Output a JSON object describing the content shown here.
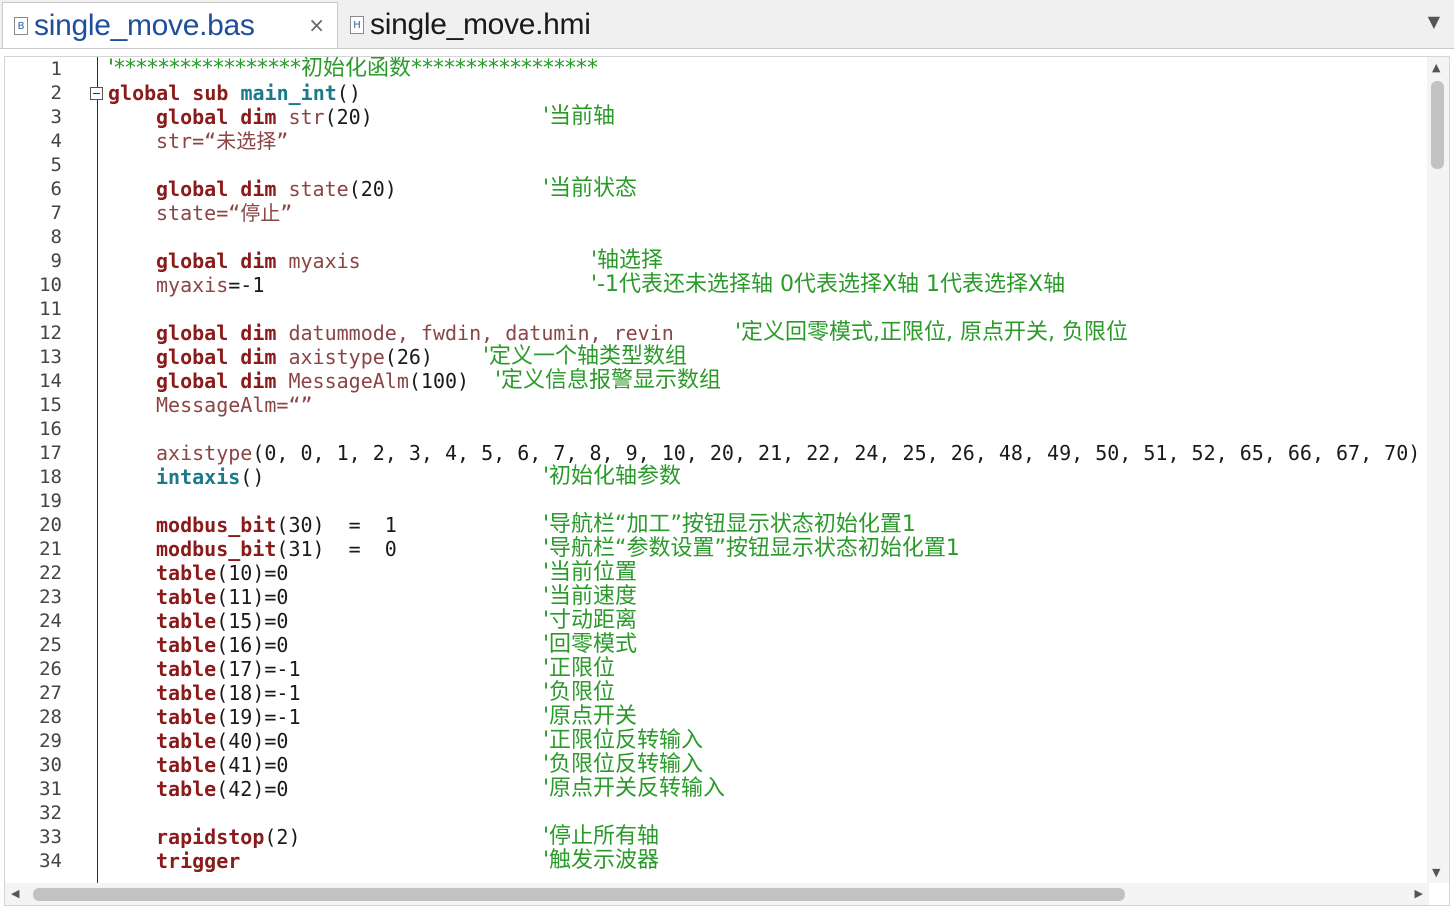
{
  "tabs": [
    {
      "title": "single_move.bas",
      "icon": "bas-file-icon",
      "icon_letter": "B",
      "active": true,
      "close": "×"
    },
    {
      "title": "single_move.hmi",
      "icon": "hmi-file-icon",
      "icon_letter": "H",
      "active": false
    }
  ],
  "tab_dropdown": "▼",
  "scroll": {
    "up": "▲",
    "down": "▼",
    "left": "◀",
    "right": "▶"
  },
  "line_numbers": [
    "1",
    "2",
    "3",
    "4",
    "5",
    "6",
    "7",
    "8",
    "9",
    "10",
    "11",
    "12",
    "13",
    "14",
    "15",
    "16",
    "17",
    "18",
    "19",
    "20",
    "21",
    "22",
    "23",
    "24",
    "25",
    "26",
    "27",
    "28",
    "29",
    "30",
    "31",
    "32",
    "33",
    "34"
  ],
  "code": {
    "l1_comment": "'*****************初始化函数*****************",
    "l2": {
      "kw1": "global",
      "kw2": "sub",
      "fn": "main_int",
      "rest": "()"
    },
    "l3": {
      "kw1": "global",
      "kw2": "dim",
      "ident": "str",
      "rest": "(20)",
      "comment": "'当前轴"
    },
    "l4": {
      "ident": "str",
      "rest": "=“未选择”"
    },
    "l6": {
      "kw1": "global",
      "kw2": "dim",
      "ident": "state",
      "rest": "(20)",
      "comment": "'当前状态"
    },
    "l7": {
      "ident": "state",
      "rest": "=“停止”"
    },
    "l9": {
      "kw1": "global",
      "kw2": "dim",
      "ident": "myaxis",
      "comment": "'轴选择"
    },
    "l10": {
      "ident": "myaxis",
      "rest": "=-1",
      "comment": "'-1代表还未选择轴 0代表选择X轴 1代表选择X轴"
    },
    "l12": {
      "kw1": "global",
      "kw2": "dim",
      "ident": "datummode, fwdin, datumin, revin",
      "comment": "'定义回零模式,正限位, 原点开关, 负限位"
    },
    "l13": {
      "kw1": "global",
      "kw2": "dim",
      "ident": "axistype",
      "rest": "(26)",
      "comment": "'定义一个轴类型数组"
    },
    "l14": {
      "kw1": "global",
      "kw2": "dim",
      "ident": "MessageAlm",
      "rest": "(100)",
      "comment": "'定义信息报警显示数组"
    },
    "l15": {
      "ident": "MessageAlm",
      "rest": "=“”"
    },
    "l17": {
      "ident": "axistype",
      "rest": "(0, 0, 1, 2, 3, 4, 5, 6, 7, 8, 9, 10, 20, 21, 22, 24, 25, 26, 48, 49, 50, 51, 52, 65, 66, 67, 70)"
    },
    "l18": {
      "fn": "intaxis",
      "rest": "()",
      "comment": "'初始化轴参数"
    },
    "l20": {
      "kw": "modbus_bit",
      "rest": "(30)  =  1",
      "comment": "'导航栏“加工”按钮显示状态初始化置1"
    },
    "l21": {
      "kw": "modbus_bit",
      "rest": "(31)  =  0",
      "comment": "'导航栏“参数设置”按钮显示状态初始化置1"
    },
    "l22": {
      "kw": "table",
      "rest": "(10)=0",
      "comment": "'当前位置"
    },
    "l23": {
      "kw": "table",
      "rest": "(11)=0",
      "comment": "'当前速度"
    },
    "l24": {
      "kw": "table",
      "rest": "(15)=0",
      "comment": "'寸动距离"
    },
    "l25": {
      "kw": "table",
      "rest": "(16)=0",
      "comment": "'回零模式"
    },
    "l26": {
      "kw": "table",
      "rest": "(17)=-1",
      "comment": "'正限位"
    },
    "l27": {
      "kw": "table",
      "rest": "(18)=-1",
      "comment": "'负限位"
    },
    "l28": {
      "kw": "table",
      "rest": "(19)=-1",
      "comment": "'原点开关"
    },
    "l29": {
      "kw": "table",
      "rest": "(40)=0",
      "comment": "'正限位反转输入"
    },
    "l30": {
      "kw": "table",
      "rest": "(41)=0",
      "comment": "'负限位反转输入"
    },
    "l31": {
      "kw": "table",
      "rest": "(42)=0",
      "comment": "'原点开关反转输入"
    },
    "l33": {
      "kw": "rapidstop",
      "rest": "(2)",
      "comment": "'停止所有轴"
    },
    "l34": {
      "kw": "trigger",
      "comment": "'触发示波器"
    }
  },
  "colors": {
    "keyword": "#8b1a1a",
    "function": "#1a7a8a",
    "identifier": "#8b4545",
    "comment": "#2a9a2a",
    "tab_active_text": "#1f4f9a"
  }
}
